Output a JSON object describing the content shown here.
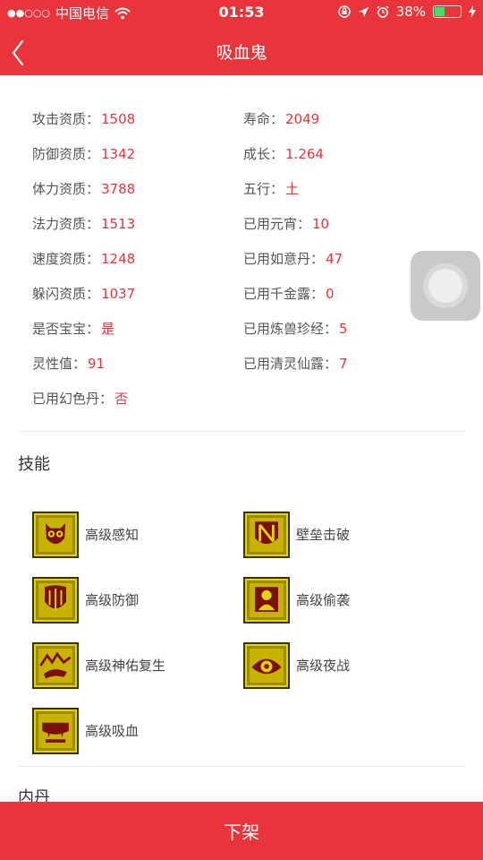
{
  "status_bar": {
    "signal": "●●○○○",
    "carrier": "中国电信",
    "time": "01:53",
    "battery_percent": "38%",
    "battery_level": 0.38
  },
  "header": {
    "title": "吸血鬼"
  },
  "attributes": [
    [
      {
        "label": "攻击资质：",
        "value": "1508"
      },
      {
        "label": "寿命：",
        "value": "2049"
      }
    ],
    [
      {
        "label": "防御资质：",
        "value": "1342"
      },
      {
        "label": "成长：",
        "value": "1.264"
      }
    ],
    [
      {
        "label": "体力资质：",
        "value": "3788"
      },
      {
        "label": "五行：",
        "value": "土"
      }
    ],
    [
      {
        "label": "法力资质：",
        "value": "1513"
      },
      {
        "label": "已用元宵：",
        "value": "10"
      }
    ],
    [
      {
        "label": "速度资质：",
        "value": "1248"
      },
      {
        "label": "已用如意丹：",
        "value": "47"
      }
    ],
    [
      {
        "label": "躲闪资质：",
        "value": "1037"
      },
      {
        "label": "已用千金露：",
        "value": "0"
      }
    ],
    [
      {
        "label": "是否宝宝：",
        "value": "是"
      },
      {
        "label": "已用炼兽珍经：",
        "value": "5"
      }
    ],
    [
      {
        "label": "灵性值：",
        "value": "91"
      },
      {
        "label": "已用清灵仙露：",
        "value": "7"
      }
    ],
    [
      {
        "label": "已用幻色丹：",
        "value": "否"
      }
    ]
  ],
  "skills_title": "技能",
  "skills": [
    {
      "name": "高级感知",
      "icon": "owl-icon"
    },
    {
      "name": "壁垒击破",
      "icon": "shield-break-icon"
    },
    {
      "name": "高级防御",
      "icon": "shield-icon"
    },
    {
      "name": "高级偷袭",
      "icon": "sneak-attack-icon"
    },
    {
      "name": "高级神佑复生",
      "icon": "revive-icon"
    },
    {
      "name": "高级夜战",
      "icon": "eye-icon"
    },
    {
      "name": "高级吸血",
      "icon": "vampire-icon"
    }
  ],
  "neidan_title": "内丹",
  "action_button": "下架",
  "colors": {
    "accent": "#e8343a",
    "value_text": "#e8343a",
    "skill_icon_bg": "#c8b400"
  }
}
